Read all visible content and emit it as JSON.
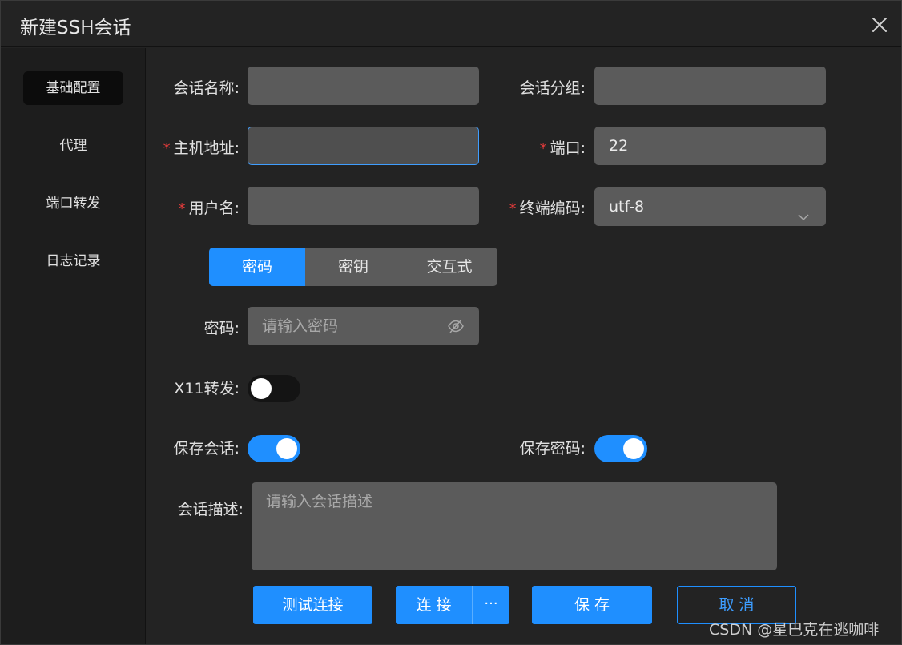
{
  "dialog": {
    "title": "新建SSH会话"
  },
  "sidebar": {
    "items": [
      {
        "label": "基础配置",
        "active": true
      },
      {
        "label": "代理"
      },
      {
        "label": "端口转发"
      },
      {
        "label": "日志记录"
      }
    ]
  },
  "form": {
    "required_mark": "*",
    "session_name": {
      "label": "会话名称:",
      "value": ""
    },
    "session_group": {
      "label": "会话分组:",
      "value": ""
    },
    "host": {
      "label": "主机地址:",
      "value": ""
    },
    "port": {
      "label": "端口:",
      "value": "22"
    },
    "username": {
      "label": "用户名:",
      "value": ""
    },
    "encoding": {
      "label": "终端编码:",
      "value": "utf-8"
    },
    "auth_tabs": [
      "密码",
      "密钥",
      "交互式"
    ],
    "password": {
      "label": "密码:",
      "placeholder": "请输入密码"
    },
    "x11": {
      "label": "X11转发:",
      "enabled": false
    },
    "save_session": {
      "label": "保存会话:",
      "enabled": true
    },
    "save_password": {
      "label": "保存密码:",
      "enabled": true
    },
    "description": {
      "label": "会话描述:",
      "placeholder": "请输入会话描述"
    }
  },
  "buttons": {
    "test": "测试连接",
    "connect": "连 接",
    "more": "···",
    "save": "保 存",
    "cancel": "取 消"
  },
  "watermark": "CSDN @星巴克在逃咖啡",
  "colors": {
    "accent": "#1f8fff",
    "required": "#e03b3b",
    "background": "#232323",
    "input": "#5b5b5b"
  }
}
